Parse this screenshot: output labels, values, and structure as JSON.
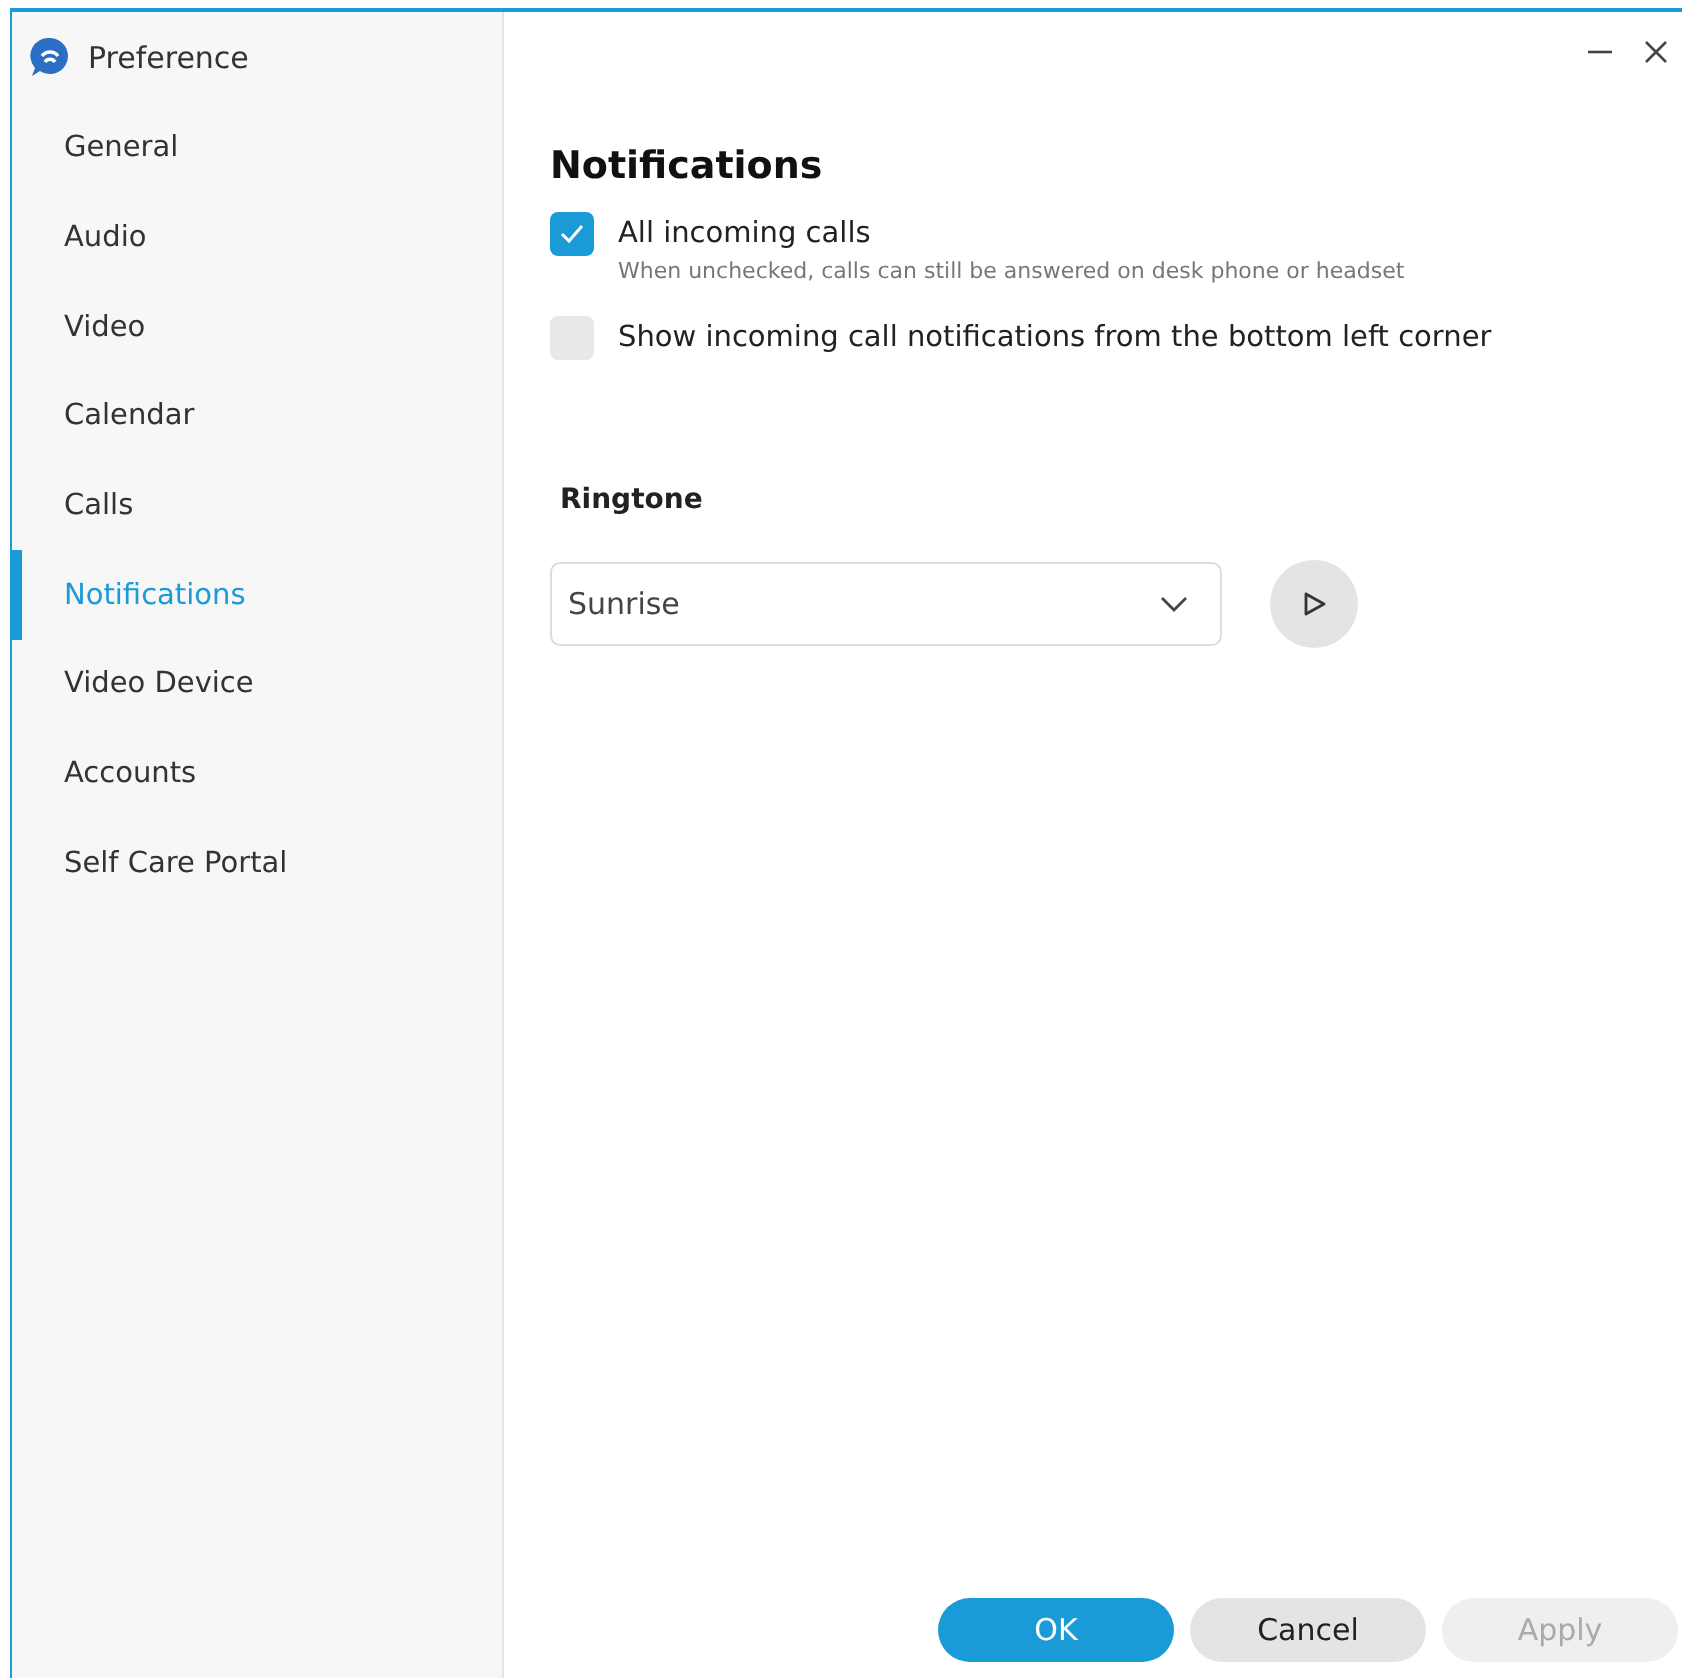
{
  "window": {
    "title": "Preference"
  },
  "sidebar": {
    "items": [
      {
        "label": "General",
        "selected": false
      },
      {
        "label": "Audio",
        "selected": false
      },
      {
        "label": "Video",
        "selected": false
      },
      {
        "label": "Calendar",
        "selected": false
      },
      {
        "label": "Calls",
        "selected": false
      },
      {
        "label": "Notifications",
        "selected": true
      },
      {
        "label": "Video Device",
        "selected": false
      },
      {
        "label": "Accounts",
        "selected": false
      },
      {
        "label": "Self Care Portal",
        "selected": false
      }
    ]
  },
  "page": {
    "title": "Notifications",
    "options": [
      {
        "label": "All incoming calls",
        "hint": "When unchecked, calls can still be answered on desk phone or headset",
        "checked": true
      },
      {
        "label": "Show incoming call notifications from the bottom left corner",
        "checked": false
      }
    ],
    "ringtone": {
      "label": "Ringtone",
      "value": "Sunrise"
    }
  },
  "buttons": [
    {
      "label": "OK",
      "kind": "primary",
      "disabled": false
    },
    {
      "label": "Cancel",
      "kind": "secondary",
      "disabled": false
    },
    {
      "label": "Apply",
      "kind": "secondary",
      "disabled": true
    }
  ]
}
